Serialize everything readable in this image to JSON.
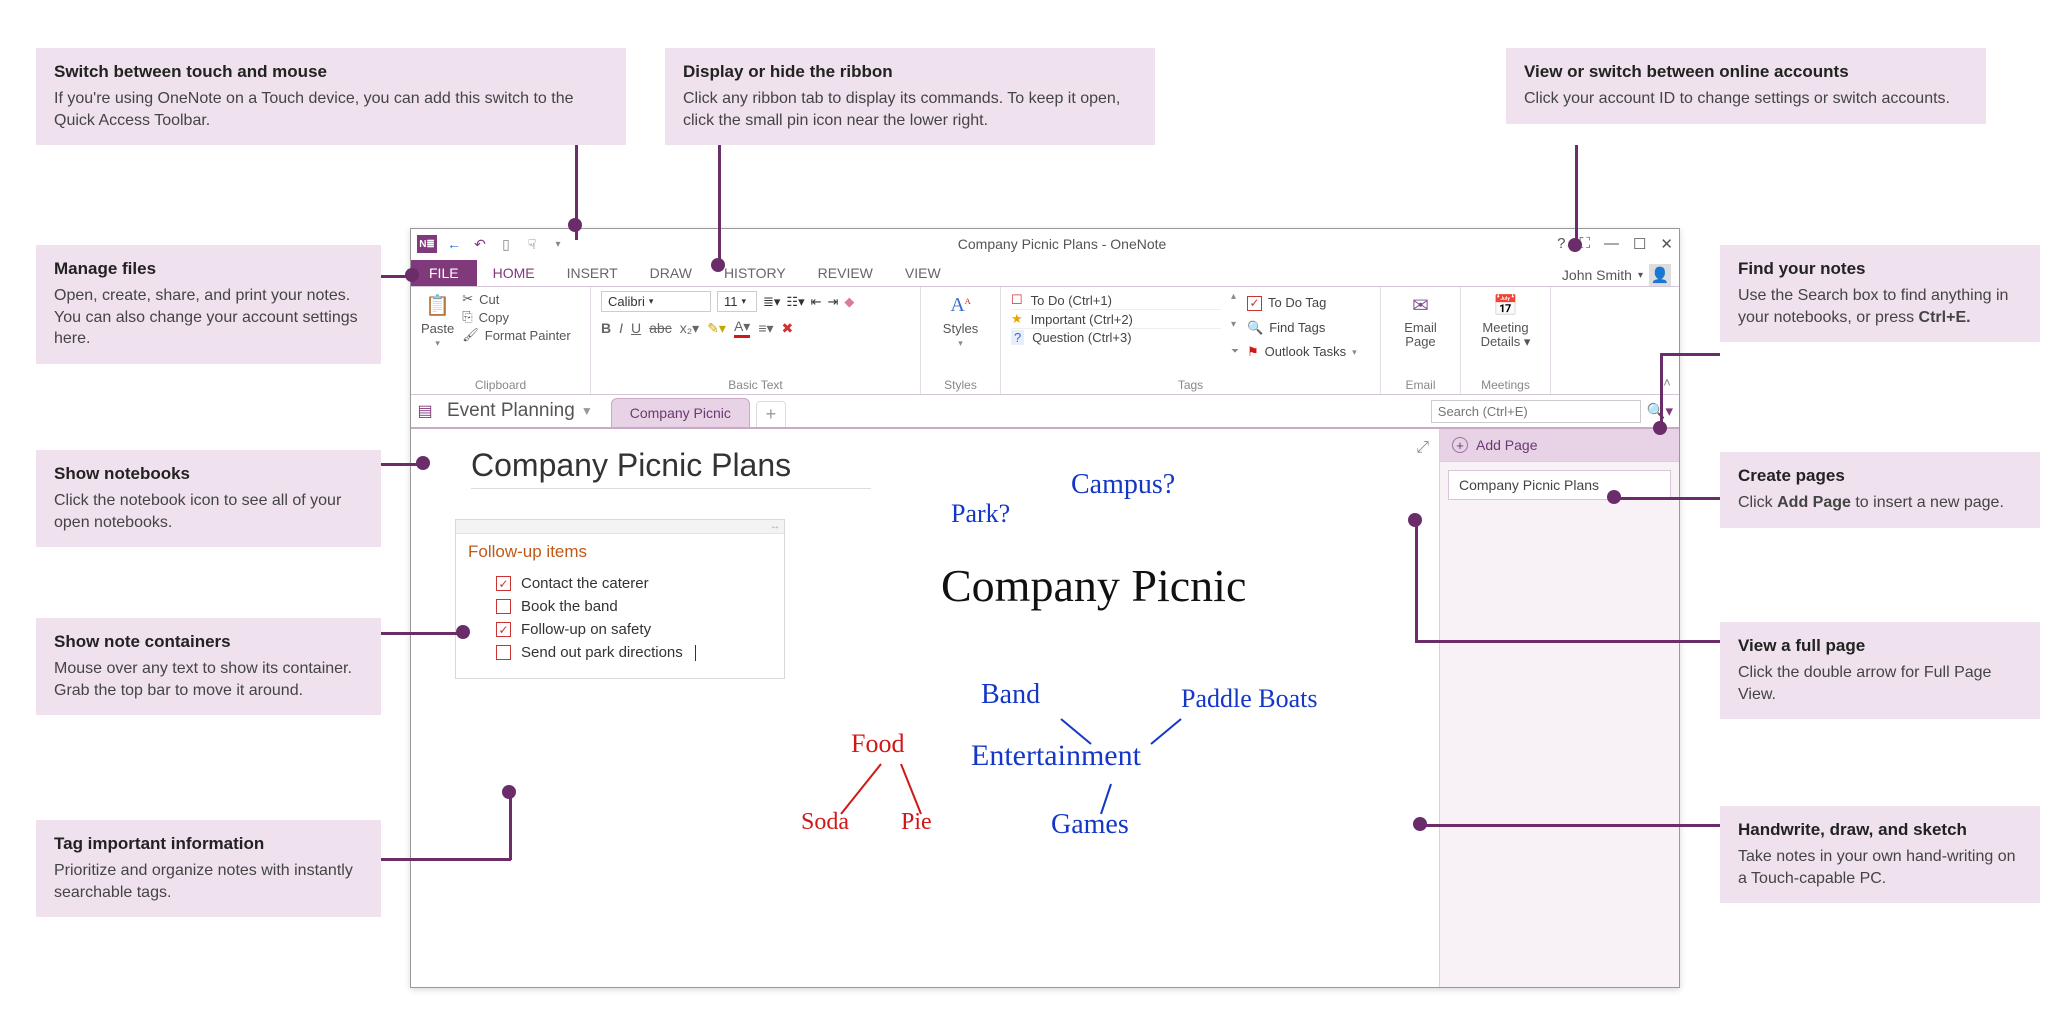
{
  "callouts": {
    "touch": {
      "title": "Switch between touch and mouse",
      "body": "If you're using OneNote on a Touch device, you can add this switch to the Quick Access Toolbar."
    },
    "ribbon": {
      "title": "Display or hide the ribbon",
      "body": "Click any ribbon tab to display its commands. To keep it open, click the small pin icon near the lower right."
    },
    "accounts": {
      "title": "View or switch between online accounts",
      "body": "Click your account ID to change settings or switch accounts."
    },
    "manage": {
      "title": "Manage files",
      "body": "Open, create, share, and print your notes. You can also change your account settings here."
    },
    "find": {
      "title": "Find your notes",
      "body_prefix": "Use the Search box to find anything in your notebooks, or press ",
      "body_bold": "Ctrl+E."
    },
    "notebooks": {
      "title": "Show notebooks",
      "body": "Click the notebook icon to see all of your open notebooks."
    },
    "createpages": {
      "title": "Create pages",
      "body_prefix": "Click ",
      "body_bold": "Add Page",
      "body_suffix": " to insert a new page."
    },
    "containers": {
      "title": "Show note containers",
      "body": "Mouse over any text to show its container. Grab the top bar to move it around."
    },
    "fullpage": {
      "title": "View a full page",
      "body": "Click the double arrow for Full Page View."
    },
    "taginfo": {
      "title": "Tag important information",
      "body": "Prioritize and organize notes with instantly searchable tags."
    },
    "handwrite": {
      "title": "Handwrite, draw, and sketch",
      "body": "Take notes in your own hand-writing on a Touch-capable PC."
    }
  },
  "titlebar": {
    "title": "Company Picnic Plans - OneNote"
  },
  "tabs": {
    "file": "FILE",
    "home": "HOME",
    "insert": "INSERT",
    "draw": "DRAW",
    "history": "HISTORY",
    "review": "REVIEW",
    "view": "VIEW",
    "account": "John Smith"
  },
  "ribbon": {
    "clipboard": {
      "paste": "Paste",
      "cut": "Cut",
      "copy": "Copy",
      "painter": "Format Painter",
      "label": "Clipboard"
    },
    "basictext": {
      "font": "Calibri",
      "size": "11",
      "label": "Basic Text"
    },
    "styles": {
      "btn": "Styles",
      "label": "Styles"
    },
    "tags": {
      "rows": [
        {
          "icon": "☐",
          "text": "To Do (Ctrl+1)"
        },
        {
          "icon": "★",
          "text": "Important (Ctrl+2)"
        },
        {
          "icon": "?",
          "text": "Question (Ctrl+3)"
        }
      ],
      "actions": {
        "todo": "To Do Tag",
        "find": "Find Tags",
        "outlook": "Outlook Tasks"
      },
      "label": "Tags"
    },
    "email": {
      "btn": "Email Page",
      "label": "Email"
    },
    "meetings": {
      "btn": "Meeting Details",
      "label": "Meetings"
    }
  },
  "notebook": {
    "name": "Event Planning",
    "section": "Company Picnic",
    "search_placeholder": "Search (Ctrl+E)"
  },
  "page": {
    "title": "Company Picnic Plans",
    "container_title": "Follow-up items",
    "items": [
      {
        "checked": true,
        "text": "Contact the caterer"
      },
      {
        "checked": false,
        "text": "Book the band"
      },
      {
        "checked": true,
        "text": "Follow-up on safety"
      },
      {
        "checked": false,
        "text": "Send out park directions"
      }
    ],
    "addpage": "Add Page",
    "pagelist0": "Company Picnic Plans"
  },
  "handwriting": {
    "park": "Park?",
    "campus": "Campus?",
    "headline": "Company Picnic",
    "food": "Food",
    "soda": "Soda",
    "pie": "Pie",
    "band": "Band",
    "entertainment": "Entertainment",
    "games": "Games",
    "paddle": "Paddle Boats"
  }
}
